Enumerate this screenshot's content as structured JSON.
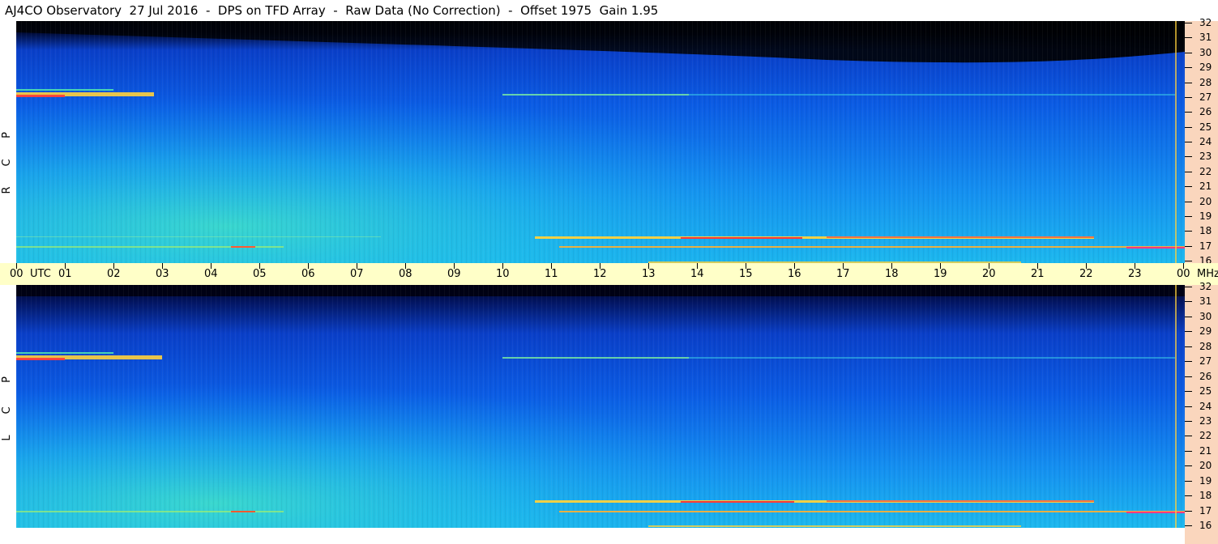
{
  "window": {
    "title": "AJ4CO Observatory  27 Jul 2016  -  DPS on TFD Array  -  Raw Data (No Correction)  -  Offset 1975  Gain 1.95"
  },
  "panels": [
    {
      "name": "RCP",
      "letters": [
        "P",
        "C",
        "R"
      ]
    },
    {
      "name": "LCP",
      "letters": [
        "P",
        "C",
        "L"
      ]
    }
  ],
  "freq_axis": {
    "unit": "MHz",
    "ticks": [
      "32",
      "31",
      "30",
      "29",
      "28",
      "27",
      "26",
      "25",
      "24",
      "23",
      "22",
      "21",
      "20",
      "19",
      "18",
      "17",
      "16"
    ]
  },
  "time_axis": {
    "unit": "UTC",
    "ticks": [
      "00",
      "01",
      "02",
      "03",
      "04",
      "05",
      "06",
      "07",
      "08",
      "09",
      "10",
      "11",
      "12",
      "13",
      "14",
      "15",
      "16",
      "17",
      "18",
      "19",
      "20",
      "21",
      "22",
      "23",
      "00"
    ]
  },
  "colors": {
    "axis_peach": "#fad6bd",
    "time_axis_yellow": "#ffffc8",
    "spectrogram_dark": "#000a2a",
    "spectrogram_blue": "#0a50e6",
    "spectrogram_cyan": "#19b4f0",
    "spectrogram_hot": "#ffd23c"
  }
}
